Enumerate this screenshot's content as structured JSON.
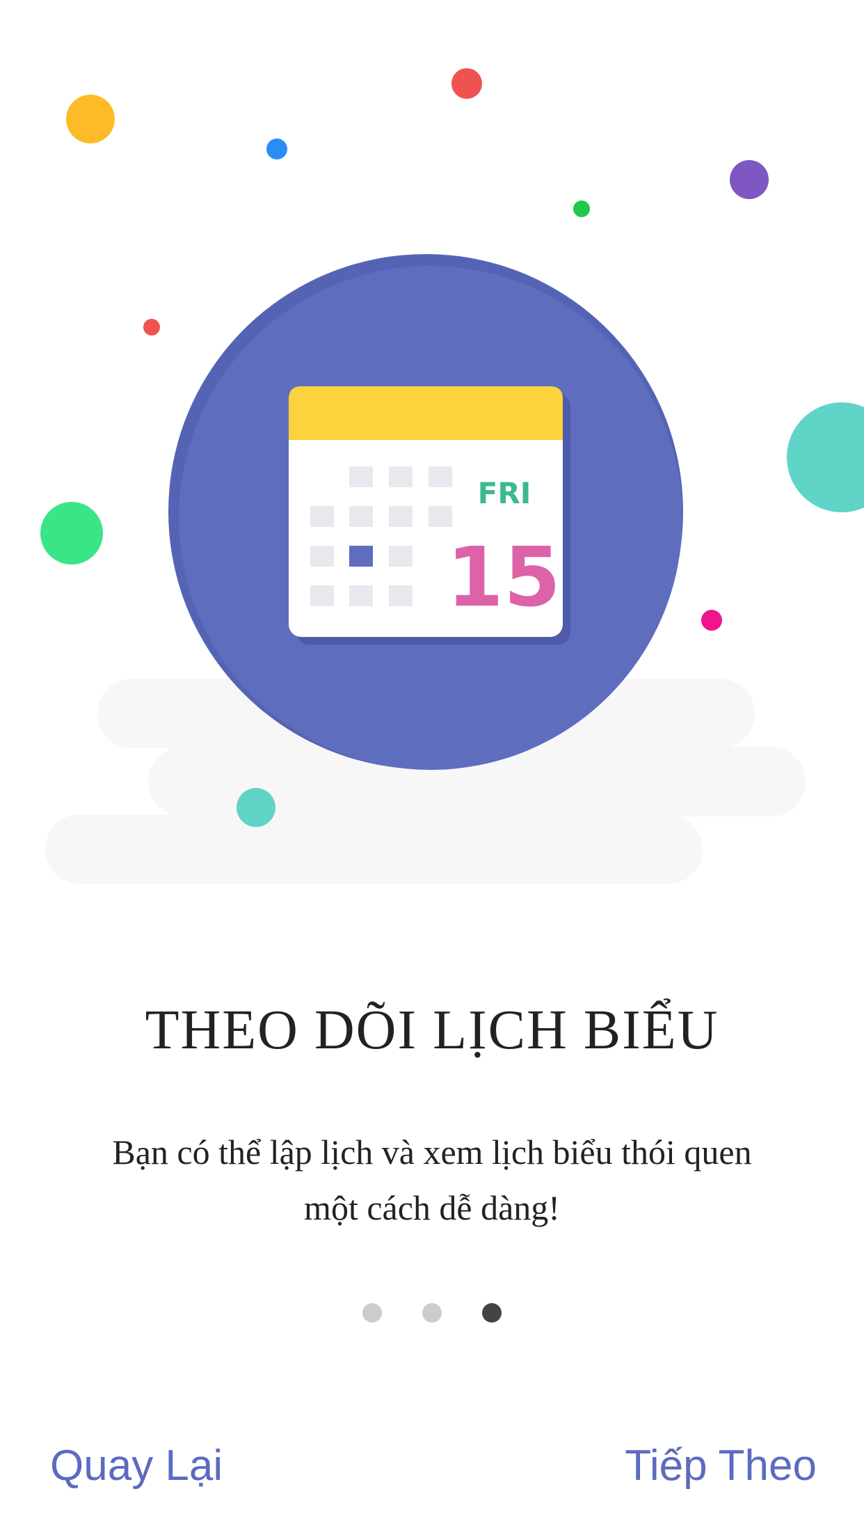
{
  "colors": {
    "accent": "#5c6bc0",
    "circle": "#5f6dbf",
    "calendar_header": "#fcd33d",
    "day_label": "#3dba8c",
    "date_number": "#dc63a8",
    "text": "#222222",
    "dot_inactive": "#cccccc",
    "dot_active": "#444444"
  },
  "illustration": {
    "calendar": {
      "day": "FRI",
      "date": "15"
    }
  },
  "onboarding": {
    "title": "THEO DÕI LỊCH BIỂU",
    "description": "Bạn có thể lập lịch và xem lịch biểu thói quen một cách dễ dàng!",
    "page_indicator": {
      "total": 3,
      "current": 3
    }
  },
  "navigation": {
    "back_label": "Quay Lại",
    "next_label": "Tiếp Theo"
  }
}
